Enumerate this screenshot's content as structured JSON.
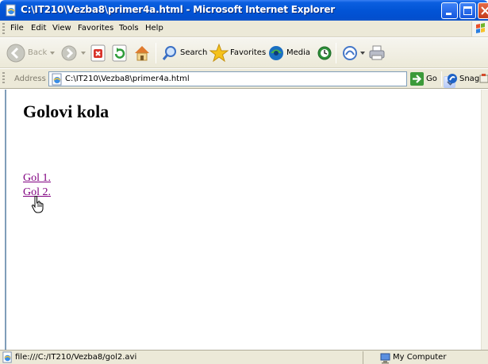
{
  "window": {
    "title": "C:\\IT210\\Vezba8\\primer4a.html - Microsoft Internet Explorer",
    "title_bar_color": "#0254d6"
  },
  "menu": {
    "items": [
      "File",
      "Edit",
      "View",
      "Favorites",
      "Tools",
      "Help"
    ]
  },
  "toolbar": {
    "back_label": "Back",
    "search_label": "Search",
    "favorites_label": "Favorites",
    "media_label": "Media",
    "go_label": "Go",
    "snagit_label": "SnagIt",
    "icons": [
      "back-icon",
      "forward-icon",
      "stop-icon",
      "refresh-icon",
      "home-icon",
      "search-icon",
      "favorites-star-icon",
      "media-icon",
      "history-icon",
      "mail-icon",
      "print-icon"
    ]
  },
  "address": {
    "label": "Address",
    "value": "C:\\IT210\\Vezba8\\primer4a.html"
  },
  "page": {
    "heading": "Golovi kola",
    "links": [
      "Gol 1.",
      "Gol 2."
    ],
    "visited_link_color": "#800080"
  },
  "status": {
    "text": "file:///C:/IT210/Vezba8/gol2.avi",
    "zone": "My Computer"
  }
}
